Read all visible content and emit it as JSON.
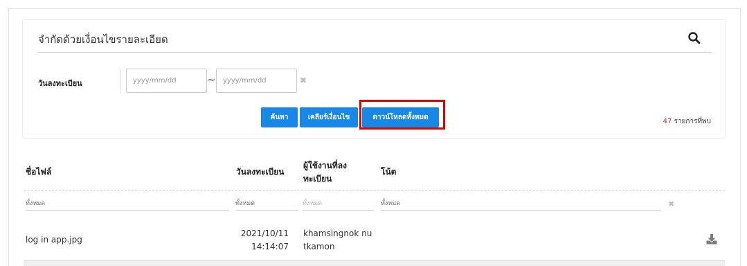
{
  "filter": {
    "title": "จำกัดด้วยเงื่อนไขรายละเอียด",
    "reg_date_label": "วันลงทะเบียน",
    "date_from_placeholder": "yyyy/mm/dd",
    "date_to_placeholder": "yyyy/mm/dd",
    "range_separator": "~",
    "clear_symbol": "✖",
    "search_icon": "search-icon"
  },
  "buttons": {
    "search_label": "ค้นหา",
    "clear_label": "เคลียร์เงื่อนไข",
    "download_all_label": "ดาวน์โหลดทั้งหมด"
  },
  "results": {
    "count": "47",
    "count_suffix": " รายการที่พบ"
  },
  "table": {
    "headers": {
      "filename": "ชื่อไฟล์",
      "reg_date": "วันลงทะเบียน",
      "reg_user_line1": "ผู้ใช้งานที่ลง",
      "reg_user_line2": "ทะเบียน",
      "note": "โน้ต"
    },
    "filter_placeholders": {
      "filename": "ทั้งหมด",
      "reg_date": "ทั้งหมด",
      "reg_user": "ทั้งหมด",
      "note": "ทั้งหมด"
    },
    "filter_clear_symbol": "✖",
    "rows": [
      {
        "filename": "log in app.jpg",
        "date": "2021/10/11",
        "time": "14:14:07",
        "user_line1": "khamsingnok nu",
        "user_line2": "tkamon",
        "note": "",
        "action_icon": "download-icon"
      }
    ]
  },
  "colors": {
    "primary_button": "#1787e8",
    "highlight_border": "#e00000",
    "count_number": "#c9302c"
  }
}
